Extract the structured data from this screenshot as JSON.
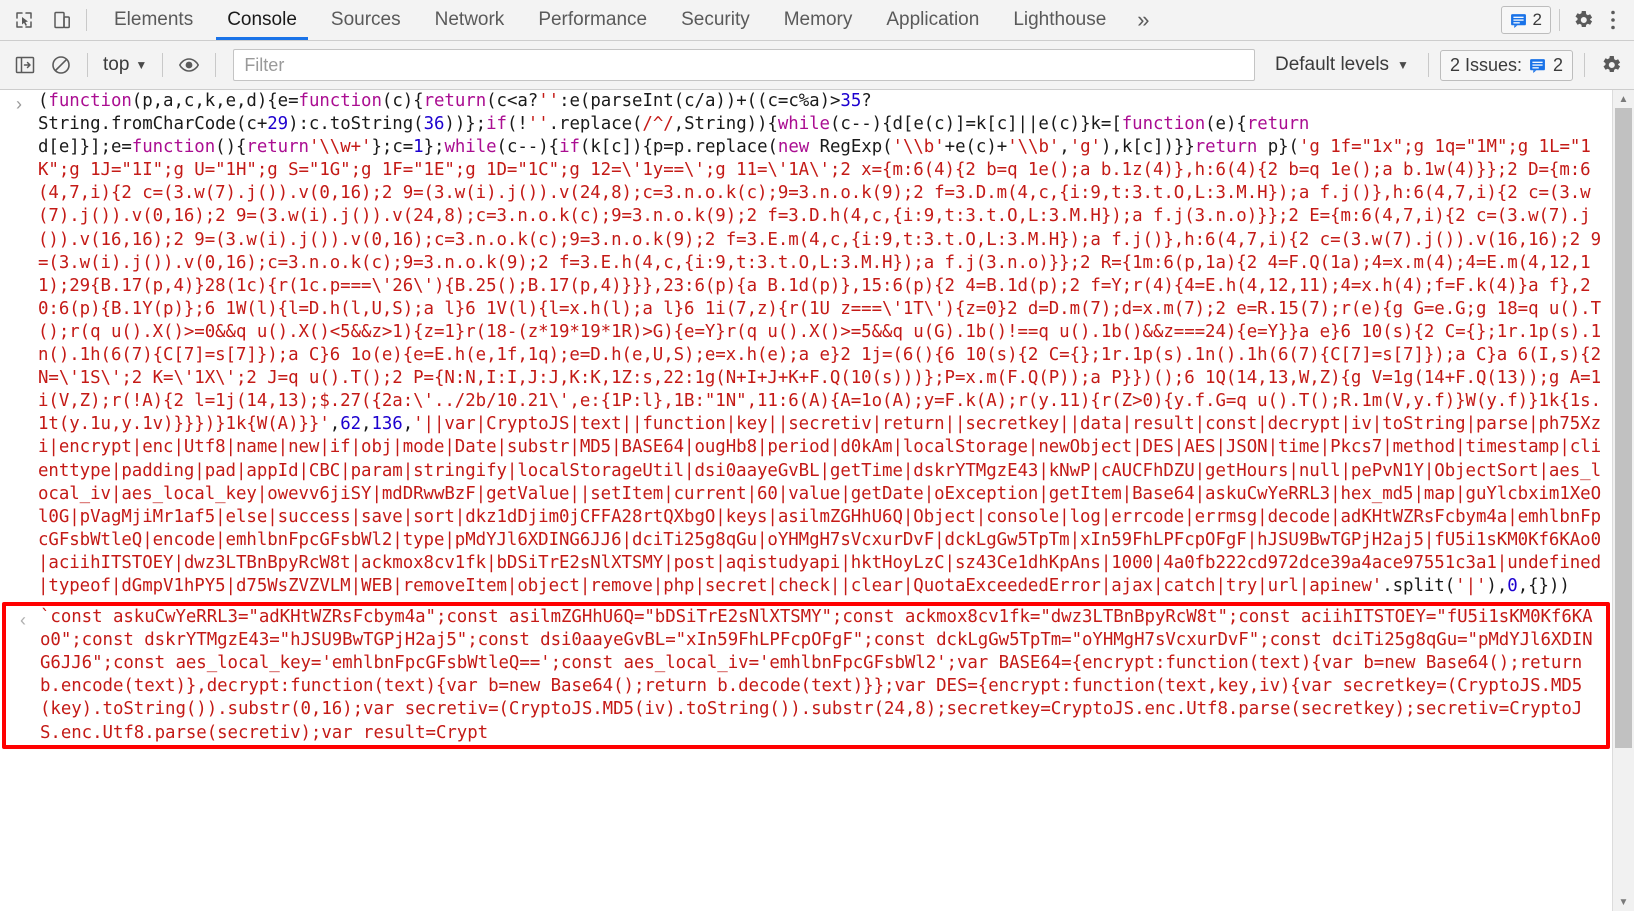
{
  "tabbar": {
    "icons": [
      {
        "name": "inspect-element-icon",
        "glyph": "⬚"
      },
      {
        "name": "device-toolbar-icon",
        "glyph": "▭"
      }
    ],
    "tabs": [
      {
        "label": "Elements",
        "active": false
      },
      {
        "label": "Console",
        "active": true
      },
      {
        "label": "Sources",
        "active": false
      },
      {
        "label": "Network",
        "active": false
      },
      {
        "label": "Performance",
        "active": false
      },
      {
        "label": "Security",
        "active": false
      },
      {
        "label": "Memory",
        "active": false
      },
      {
        "label": "Application",
        "active": false
      },
      {
        "label": "Lighthouse",
        "active": false
      }
    ],
    "more_label": "»",
    "issues_count": "2",
    "settings_title": "Settings",
    "more_options_title": "More options"
  },
  "filterbar": {
    "sidebar_toggle_name": "console-sidebar-toggle",
    "clear_console_name": "clear-console-icon",
    "context_value": "top",
    "eye_icon_name": "live-expression-icon",
    "filter_placeholder": "Filter",
    "filter_value": "",
    "levels_label": "Default levels",
    "issues_label": "2 Issues:",
    "issues_count": "2",
    "settings_title": "Console settings"
  },
  "accent_colors": {
    "tab_underline": "#1a73e8",
    "issue_badge": "#1a73e8",
    "annotation_box": "#ff0000",
    "string_red": "#c41a16",
    "number_blue": "#1c00cf",
    "keyword_purple": "#aa0d91"
  },
  "console": {
    "input_entry": {
      "gutter_glyph": "›",
      "name": "console-input-echo",
      "tokens": [
        {
          "t": "(",
          "c": "dark"
        },
        {
          "t": "function",
          "c": "purple"
        },
        {
          "t": "(p,a,c,k,e,d){e=",
          "c": "dark"
        },
        {
          "t": "function",
          "c": "purple"
        },
        {
          "t": "(c){",
          "c": "dark"
        },
        {
          "t": "return",
          "c": "purple"
        },
        {
          "t": "(c<a?",
          "c": "dark"
        },
        {
          "t": "''",
          "c": "red"
        },
        {
          "t": ":e(parseInt(c/a))+((c=c%a)>",
          "c": "dark"
        },
        {
          "t": "35",
          "c": "blue"
        },
        {
          "t": "?\nString.fromCharCode(c+",
          "c": "dark"
        },
        {
          "t": "29",
          "c": "blue"
        },
        {
          "t": "):c.toString(",
          "c": "dark"
        },
        {
          "t": "36",
          "c": "blue"
        },
        {
          "t": "))};",
          "c": "dark"
        },
        {
          "t": "if",
          "c": "purple"
        },
        {
          "t": "(!",
          "c": "dark"
        },
        {
          "t": "''",
          "c": "red"
        },
        {
          "t": ".replace(",
          "c": "dark"
        },
        {
          "t": "/^/",
          "c": "red"
        },
        {
          "t": ",String)){",
          "c": "dark"
        },
        {
          "t": "while",
          "c": "purple"
        },
        {
          "t": "(c--){d[e(c)]=k[c]||e(c)}k=[",
          "c": "dark"
        },
        {
          "t": "function",
          "c": "purple"
        },
        {
          "t": "(e){",
          "c": "dark"
        },
        {
          "t": "return",
          "c": "purple"
        },
        {
          "t": "\nd[e]}];e=",
          "c": "dark"
        },
        {
          "t": "function",
          "c": "purple"
        },
        {
          "t": "(){",
          "c": "dark"
        },
        {
          "t": "return",
          "c": "purple"
        },
        {
          "t": "'\\\\w+'",
          "c": "red"
        },
        {
          "t": "};c=",
          "c": "dark"
        },
        {
          "t": "1",
          "c": "blue"
        },
        {
          "t": "};",
          "c": "dark"
        },
        {
          "t": "while",
          "c": "purple"
        },
        {
          "t": "(c--){",
          "c": "dark"
        },
        {
          "t": "if",
          "c": "purple"
        },
        {
          "t": "(k[c]){p=p.replace(",
          "c": "dark"
        },
        {
          "t": "new",
          "c": "purple"
        },
        {
          "t": " RegExp(",
          "c": "dark"
        },
        {
          "t": "'\\\\b'",
          "c": "red"
        },
        {
          "t": "+e(c)+",
          "c": "dark"
        },
        {
          "t": "'\\\\b'",
          "c": "red"
        },
        {
          "t": ",",
          "c": "dark"
        },
        {
          "t": "'g'",
          "c": "red"
        },
        {
          "t": "),k[c])}}",
          "c": "dark"
        },
        {
          "t": "return",
          "c": "purple"
        },
        {
          "t": " p}(",
          "c": "dark"
        },
        {
          "t": "'g 1f=\"1x\";g 1q=\"1M\";g 1L=\"1K\";g 1J=\"1I\";g U=\"1H\";g S=\"1G\";g 1F=\"1E\";g 1D=\"1C\";g 12=\\'1y==\\';g 11=\\'1A\\';2 x={m:6(4){2 b=q 1e();a b.1z(4)},h:6(4){2 b=q 1e();a b.1w(4)}};2 D={m:6(4,7,i){2 c=(3.w(7).j()).v(0,16);2 9=(3.w(i).j()).v(24,8);c=3.n.o.k(c);9=3.n.o.k(9);2 f=3.D.m(4,c,{i:9,t:3.t.O,L:3.M.H});a f.j()},h:6(4,7,i){2 c=(3.w(7).j()).v(0,16);2 9=(3.w(i).j()).v(24,8);c=3.n.o.k(c);9=3.n.o.k(9);2 f=3.D.h(4,c,{i:9,t:3.t.O,L:3.M.H});a f.j(3.n.o)}};2 E={m:6(4,7,i){2 c=(3.w(7).j()).v(16,16);2 9=(3.w(i).j()).v(0,16);c=3.n.o.k(c);9=3.n.o.k(9);2 f=3.E.m(4,c,{i:9,t:3.t.O,L:3.M.H});a f.j()},h:6(4,7,i){2 c=(3.w(7).j()).v(16,16);2 9=(3.w(i).j()).v(0,16);c=3.n.o.k(c);9=3.n.o.k(9);2 f=3.E.h(4,c,{i:9,t:3.t.O,L:3.M.H});a f.j(3.n.o)}};2 R={1m:6(p,1a){2 4=F.Q(1a);4=x.m(4);4=E.m(4,12,11);29{B.17(p,4)}28(1c){r(1c.p===\\'26\\'){B.25();B.17(p,4)}}},23:6(p){a B.1d(p)},15:6(p){2 4=B.1d(p);2 f=Y;r(4){4=E.h(4,12,11);4=x.h(4);f=F.k(4)}a f},20:6(p){B.1Y(p)};6 1W(l){l=D.h(l,U,S);a l}6 1V(l){l=x.h(l);a l}6 1i(7,z){r(1U z===\\'1T\\'){z=0}2 d=D.m(7);d=x.m(7);2 e=R.15(7);r(e){g G=e.G;g 18=q u().T();r(q u().X()>=0&&q u().X()<5&&z>1){z=1}r(18-(z*19*19*1R)>G){e=Y}r(q u().X()>=5&&q u(G).1b()!==q u().1b()&&z===24){e=Y}}a e}6 10(s){2 C={};1r.1p(s).1n().1h(6(7){C[7]=s[7]});a C}6 1o(e){e=E.h(e,1f,1q);e=D.h(e,U,S);e=x.h(e);a e}2 1j=(6(){6 10(s){2 C={};1r.1p(s).1n().1h(6(7){C[7]=s[7]});a C}a 6(I,s){2 N=\\'1S\\';2 K=\\'1X\\';2 J=q u().T();2 P={N:N,I:I,J:J,K:K,1Z:s,22:1g(N+I+J+K+F.Q(10(s)))};P=x.m(F.Q(P));a P}})();6 1Q(14,13,W,Z){g V=1g(14+F.Q(13));g A=1i(V,Z);r(!A){2 l=1j(14,13);$.27({2a:\\'../2b/10.21\\',e:{1P:l},1B:\"1N\",11:6(A){A=1o(A);y=F.k(A);r(y.11){r(Z>0){y.f.G=q u().T();R.1m(V,y.f)}W(y.f)}1k{1s.1t(y.1u,y.1v)}}})}1k{W(A)}}'",
          "c": "red"
        },
        {
          "t": ",",
          "c": "dark"
        },
        {
          "t": "62",
          "c": "blue"
        },
        {
          "t": ",",
          "c": "dark"
        },
        {
          "t": "136",
          "c": "blue"
        },
        {
          "t": ",",
          "c": "dark"
        },
        {
          "t": "'||var|CryptoJS|text||function|key||secretiv|return||secretkey||data|result|const|decrypt|iv|toString|parse|ph75Xzi|encrypt|enc|Utf8|name|new|if|obj|mode|Date|substr|MD5|BASE64|ougHb8|period|d0kAm|localStorage|newObject|DES|AES|JSON|time|Pkcs7|method|timestamp|clienttype|padding|pad|appId|CBC|param|stringify|localStorageUtil|dsi0aayeGvBL|getTime|dskrYTMgzE43|kNwP|cAUCFhDZU|getHours|null|pePvN1Y|ObjectSort|aes_local_iv|aes_local_key|owevv6jiSY|mdDRwwBzF|getValue||setItem|current|60|value|getDate|oException|getItem|Base64|askuCwYeRRL3|hex_md5|map|guYlcbxim1XeOl0G|pVagMjiMr1af5|else|success|save|sort|dkz1dDjim0jCFFA28rtQXbgO|keys|asilmZGHhU6Q|Object|console|log|errcode|errmsg|decode|adKHtWZRsFcbym4a|emhlbnFpcGFsbWtleQ|encode|emhlbnFpcGFsbWl2|type|pMdYJl6XDING6JJ6|dciTi25g8qGu|oYHMgH7sVcxurDvF|dckLgGw5TpTm|xIn59FhLPFcpOFgF|hJSU9BwTGPjH2aj5|fU5i1sKM0Kf6KAo0|aciihITSTOEY|dwz3LTBnBpyRcW8t|ackmox8cv1fk|bDSiTrE2sNlXTSMY|post|aqistudyapi|hktHoyLzC|sz43Ce1dhKpAns|1000|4a0fb222cd972dce39a4ace97551c3a1|undefined|typeof|dGmpV1hPY5|d75WsZVZVLM|WEB|removeItem|object|remove|php|secret|check||clear|QuotaExceededError|ajax|catch|try|url|apinew'",
          "c": "red"
        },
        {
          "t": ".split(",
          "c": "dark"
        },
        {
          "t": "'|'",
          "c": "red"
        },
        {
          "t": "),",
          "c": "dark"
        },
        {
          "t": "0",
          "c": "blue"
        },
        {
          "t": ",{}))",
          "c": "dark"
        }
      ]
    },
    "result_entry": {
      "gutter_glyph": "‹",
      "name": "console-result-value",
      "highlighted": true,
      "text": "`const askuCwYeRRL3=\"adKHtWZRsFcbym4a\";const asilmZGHhU6Q=\"bDSiTrE2sNlXTSMY\";const ackmox8cv1fk=\"dwz3LTBnBpyRcW8t\";const aciihITSTOEY=\"fU5i1sKM0Kf6KAo0\";const dskrYTMgzE43=\"hJSU9BwTGPjH2aj5\";const dsi0aayeGvBL=\"xIn59FhLPFcpOFgF\";const dckLgGw5TpTm=\"oYHMgH7sVcxurDvF\";const dciTi25g8qGu=\"pMdYJl6XDING6JJ6\";const aes_local_key='emhlbnFpcGFsbWtleQ==';const aes_local_iv='emhlbnFpcGFsbWl2';var BASE64={encrypt:function(text){var b=new Base64();return b.encode(text)},decrypt:function(text){var b=new Base64();return b.decode(text)}};var DES={encrypt:function(text,key,iv){var secretkey=(CryptoJS.MD5(key).toString()).substr(0,16);var secretiv=(CryptoJS.MD5(iv).toString()).substr(24,8);secretkey=CryptoJS.enc.Utf8.parse(secretkey);secretiv=CryptoJS.enc.Utf8.parse(secretiv);var result=Crypt"
    }
  },
  "scrollbar": {
    "name": "console-vertical-scrollbar",
    "up_glyph": "▲",
    "down_glyph": "▼"
  }
}
